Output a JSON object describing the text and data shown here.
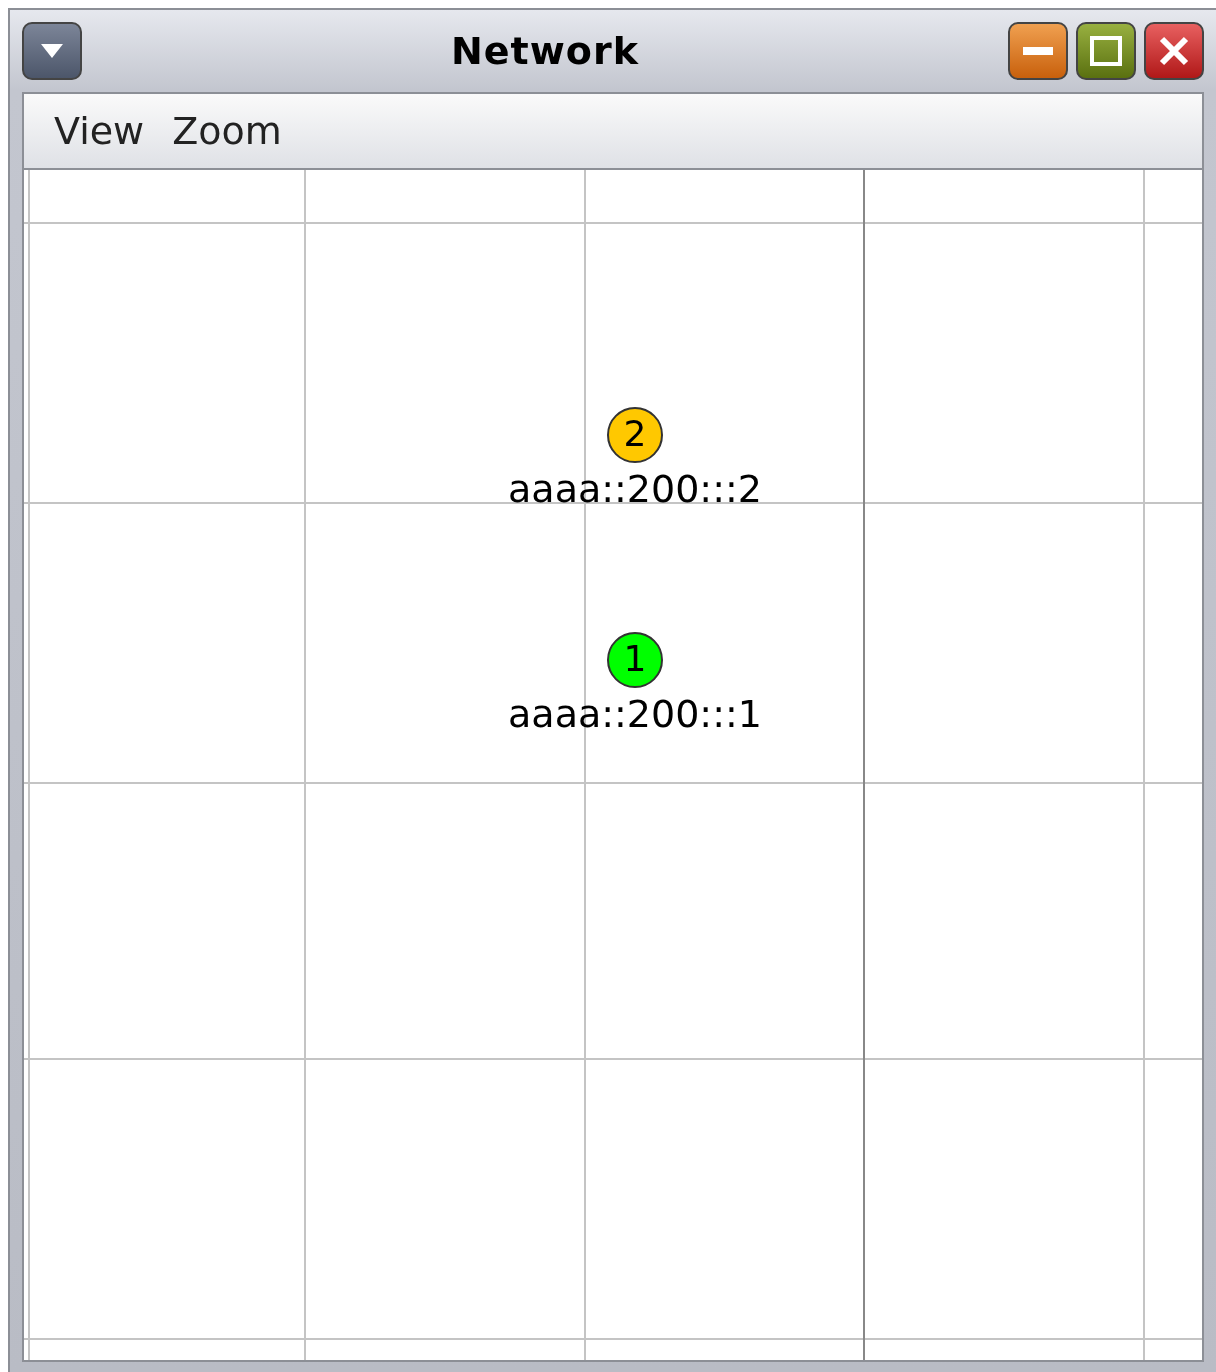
{
  "window": {
    "title": "Network"
  },
  "menu": [
    {
      "label": "View"
    },
    {
      "label": "Zoom"
    }
  ],
  "nodes": [
    {
      "number": "2",
      "address": "aaaa::200:::2",
      "color": "#ffc800"
    },
    {
      "number": "1",
      "address": "aaaa::200:::1",
      "color": "#00ff00"
    }
  ]
}
